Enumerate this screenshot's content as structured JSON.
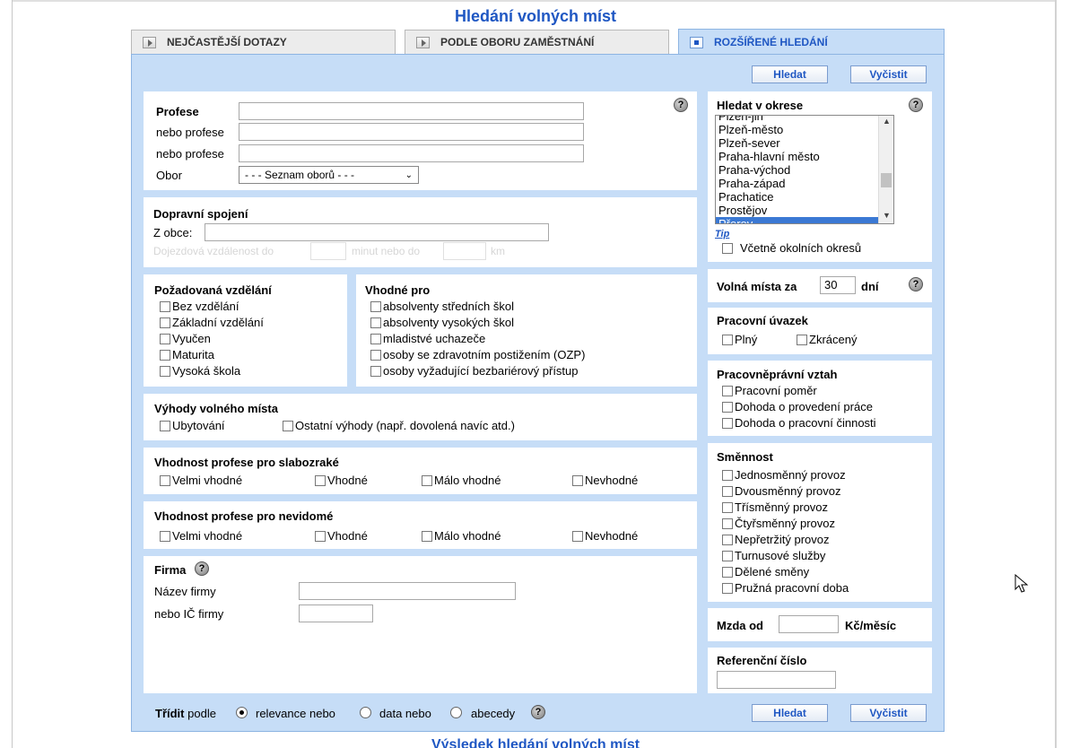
{
  "page": {
    "title": "Hledání volných míst",
    "bottom_title": "Výsledek hledání volných míst"
  },
  "tabs": [
    {
      "label": "NEJČASTĚJŠÍ DOTAZY",
      "active": false
    },
    {
      "label": "PODLE OBORU ZAMĚSTNÁNÍ",
      "active": false
    },
    {
      "label": "ROZŠÍŘENÉ HLEDÁNÍ",
      "active": true
    }
  ],
  "buttons": {
    "search": "Hledat",
    "clear": "Vyčistit"
  },
  "profese": {
    "title": "Profese",
    "alt1": "nebo profese",
    "alt2": "nebo profese",
    "obor_label": "Obor",
    "obor_select": "- - - Seznam oborů - - -",
    "value": "",
    "alt1_value": "",
    "alt2_value": ""
  },
  "doprava": {
    "title": "Dopravní spojení",
    "from_label": "Z obce:",
    "from_value": "",
    "dist_label": "Dojezdová vzdálenost do",
    "minutes_label": "minut nebo do",
    "km_label": "km"
  },
  "vzdelani": {
    "title": "Požadovaná vzdělání",
    "items": [
      "Bez vzdělání",
      "Základní vzdělání",
      "Vyučen",
      "Maturita",
      "Vysoká škola"
    ]
  },
  "vhodne": {
    "title": "Vhodné pro",
    "items": [
      "absolventy středních škol",
      "absolventy vysokých škol",
      "mladistvé uchazeče",
      "osoby se zdravotním postižením (OZP)",
      "osoby vyžadující bezbariérový přístup"
    ]
  },
  "vyhody": {
    "title": "Výhody volného místa",
    "items": [
      "Ubytování",
      "Ostatní výhody (např. dovolená navíc atd.)"
    ]
  },
  "slabozrake": {
    "title": "Vhodnost profese pro slabozraké",
    "items": [
      "Velmi vhodné",
      "Vhodné",
      "Málo vhodné",
      "Nevhodné"
    ]
  },
  "nevidome": {
    "title": "Vhodnost profese pro nevidomé",
    "items": [
      "Velmi vhodné",
      "Vhodné",
      "Málo vhodné",
      "Nevhodné"
    ]
  },
  "firma": {
    "title": "Firma",
    "name_label": "Název firmy",
    "ic_label": "nebo IČ firmy"
  },
  "sort": {
    "prefix": "Třídit",
    "podle": "podle",
    "options": [
      "relevance nebo",
      "data nebo",
      "abecedy"
    ],
    "selected": 0
  },
  "okres": {
    "title": "Hledat v okrese",
    "options": [
      "Plzeň-jih",
      "Plzeň-město",
      "Plzeň-sever",
      "Praha-hlavní město",
      "Praha-východ",
      "Praha-západ",
      "Prachatice",
      "Prostějov",
      "Přerov"
    ],
    "selected": "Přerov",
    "tip": "Tip",
    "include_nearby": "Včetně okolních okresů"
  },
  "volna_mista": {
    "prefix": "Volná místa za",
    "value": "30",
    "suffix": "dní"
  },
  "uvazek": {
    "title": "Pracovní úvazek",
    "items": [
      "Plný",
      "Zkrácený"
    ]
  },
  "vztah": {
    "title": "Pracovněprávní vztah",
    "items": [
      "Pracovní poměr",
      "Dohoda o provedení práce",
      "Dohoda o pracovní činnosti"
    ]
  },
  "smennost": {
    "title": "Směnnost",
    "items": [
      "Jednosměnný provoz",
      "Dvousměnný provoz",
      "Třísměnný provoz",
      "Čtyřsměnný provoz",
      "Nepřetržitý provoz",
      "Turnusové služby",
      "Dělené směny",
      "Pružná pracovní doba"
    ]
  },
  "mzda": {
    "prefix": "Mzda od",
    "suffix": "Kč/měsíc"
  },
  "referencni": {
    "title": "Referenční číslo"
  },
  "help_glyph": "?"
}
